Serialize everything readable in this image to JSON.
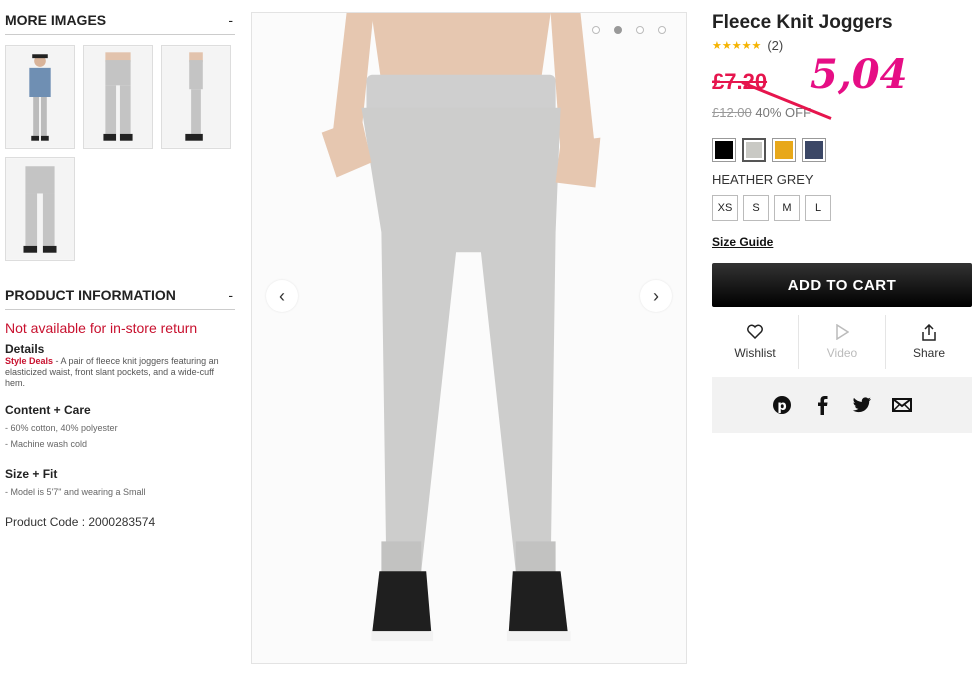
{
  "left": {
    "more_images": {
      "title": "MORE IMAGES",
      "toggle": "-"
    },
    "product_info": {
      "title": "PRODUCT INFORMATION",
      "toggle": "-",
      "not_available": "Not available for in-store return",
      "details_label": "Details",
      "style_deals_label": "Style Deals",
      "description": " - A pair of fleece knit joggers featuring an elasticized waist, front slant pockets, and a wide-cuff hem.",
      "content_care_label": "Content + Care",
      "content_care": [
        "- 60% cotton, 40% polyester",
        "- Machine wash cold"
      ],
      "size_fit_label": "Size + Fit",
      "size_fit": [
        "- Model is 5'7\" and wearing a Small"
      ],
      "product_code": "Product Code : 2000283574"
    }
  },
  "product": {
    "title": "Fleece Knit Joggers",
    "stars": "★★★★★",
    "review_count": "(2)",
    "sale_price": "£7.20",
    "handwritten_price": "5,04",
    "original_price": "£12.00",
    "discount": "40% OFF",
    "color_name": "HEATHER GREY",
    "sizes": [
      "XS",
      "S",
      "M",
      "L"
    ],
    "size_guide": "Size Guide",
    "add_to_cart": "ADD TO CART",
    "actions": {
      "wishlist": "Wishlist",
      "video": "Video",
      "share": "Share"
    },
    "swatch_colors": [
      "#000000",
      "#c9c9c4",
      "#e8a81a",
      "#3b4766"
    ],
    "colors": {
      "sale": "#e6154d",
      "handwritten": "#e60e85",
      "in_store_notice": "#c8102e"
    }
  },
  "gallery": {
    "prev": "‹",
    "next": "›"
  }
}
